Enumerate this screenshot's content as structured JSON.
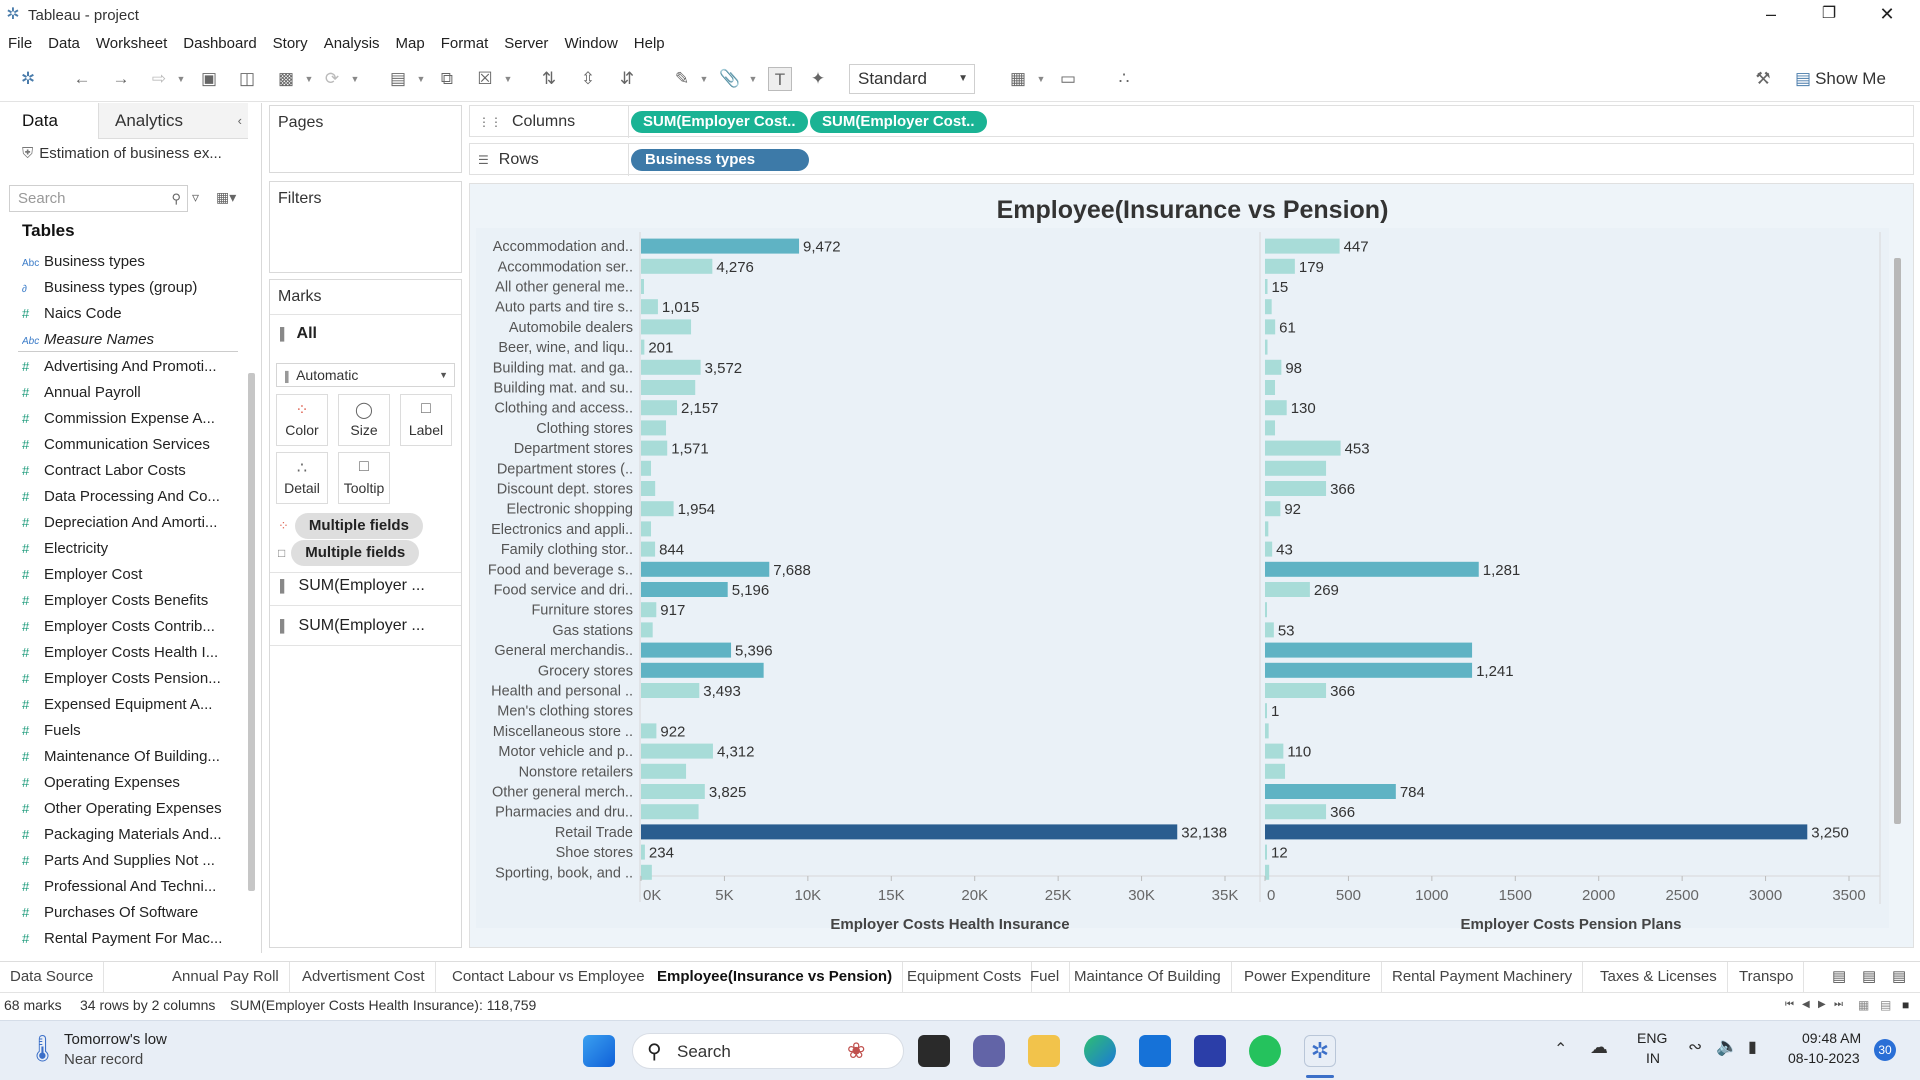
{
  "window": {
    "title": "Tableau - project"
  },
  "menu": [
    "File",
    "Data",
    "Worksheet",
    "Dashboard",
    "Story",
    "Analysis",
    "Map",
    "Format",
    "Server",
    "Window",
    "Help"
  ],
  "toolbar": {
    "fit_select": "Standard",
    "show_me": "Show Me"
  },
  "datapane": {
    "tab_data": "Data",
    "tab_analytics": "Analytics",
    "datasource": "Estimation of business ex...",
    "search_placeholder": "Search",
    "tables_heading": "Tables",
    "fields": [
      {
        "name": "Business types",
        "kind": "dim"
      },
      {
        "name": "Business types (group)",
        "kind": "group"
      },
      {
        "name": "Naics Code",
        "kind": "measure"
      },
      {
        "name": "Measure Names",
        "kind": "dim",
        "italic": true
      },
      {
        "name": "Advertising And Promoti...",
        "kind": "measure"
      },
      {
        "name": "Annual Payroll",
        "kind": "measure"
      },
      {
        "name": "Commission Expense A...",
        "kind": "measure"
      },
      {
        "name": "Communication Services",
        "kind": "measure"
      },
      {
        "name": "Contract Labor Costs",
        "kind": "measure"
      },
      {
        "name": "Data Processing And Co...",
        "kind": "measure"
      },
      {
        "name": "Depreciation And Amorti...",
        "kind": "measure"
      },
      {
        "name": "Electricity",
        "kind": "measure"
      },
      {
        "name": "Employer Cost",
        "kind": "measure"
      },
      {
        "name": "Employer Costs Benefits",
        "kind": "measure"
      },
      {
        "name": "Employer Costs Contrib...",
        "kind": "measure"
      },
      {
        "name": "Employer Costs Health I...",
        "kind": "measure"
      },
      {
        "name": "Employer Costs Pension...",
        "kind": "measure"
      },
      {
        "name": "Expensed Equipment A...",
        "kind": "measure"
      },
      {
        "name": "Fuels",
        "kind": "measure"
      },
      {
        "name": "Maintenance Of Building...",
        "kind": "measure"
      },
      {
        "name": "Operating Expenses",
        "kind": "measure"
      },
      {
        "name": "Other Operating Expenses",
        "kind": "measure"
      },
      {
        "name": "Packaging Materials And...",
        "kind": "measure"
      },
      {
        "name": "Parts And Supplies Not ...",
        "kind": "measure"
      },
      {
        "name": "Professional And Techni...",
        "kind": "measure"
      },
      {
        "name": "Purchases Of Software",
        "kind": "measure"
      },
      {
        "name": "Rental Payment For Mac...",
        "kind": "measure"
      }
    ]
  },
  "shelves": {
    "pages": "Pages",
    "filters": "Filters",
    "marks": "Marks",
    "marks_all": "All",
    "mark_type": "Automatic",
    "mark_buttons": [
      "Color",
      "Size",
      "Label",
      "Detail",
      "Tooltip"
    ],
    "mark_pills": [
      "Multiple fields",
      "Multiple fields"
    ],
    "mark_measures": [
      "SUM(Employer ...",
      "SUM(Employer ..."
    ],
    "columns_label": "Columns",
    "rows_label": "Rows",
    "column_pills": [
      "SUM(Employer Cost..",
      "SUM(Employer Cost.."
    ],
    "row_pill": "Business types"
  },
  "sheet_title": "Employee(Insurance vs Pension)",
  "chart_data": {
    "type": "bar",
    "title": "Employee(Insurance vs Pension)",
    "categories": [
      "Accommodation and..",
      "Accommodation ser..",
      "All other general me..",
      "Auto parts and tire s..",
      "Automobile dealers",
      "Beer, wine, and liqu..",
      "Building mat. and ga..",
      "Building mat. and su..",
      "Clothing and access..",
      "Clothing stores",
      "Department stores",
      "Department stores (..",
      "Discount dept. stores",
      "Electronic shopping",
      "Electronics and appli..",
      "Family clothing stor..",
      "Food and beverage s..",
      "Food service and dri..",
      "Furniture stores",
      "Gas stations",
      "General merchandis..",
      "Grocery stores",
      "Health and personal ..",
      "Men's clothing stores",
      "Miscellaneous store ..",
      "Motor vehicle and p..",
      "Nonstore retailers",
      "Other general merch..",
      "Pharmacies and dru..",
      "Retail Trade",
      "Shoe stores",
      "Sporting, book, and .."
    ],
    "series": [
      {
        "name": "Employer Costs Health Insurance",
        "values": [
          9472,
          4276,
          180,
          1015,
          3000,
          201,
          3572,
          3250,
          2157,
          1500,
          1571,
          600,
          850,
          1954,
          600,
          844,
          7688,
          5196,
          917,
          700,
          5396,
          7350,
          3493,
          0,
          922,
          4312,
          2700,
          3825,
          3450,
          32138,
          234,
          650
        ],
        "labels": [
          "9,472",
          "4,276",
          "",
          "1,015",
          "",
          "201",
          "3,572",
          "",
          "2,157",
          "",
          "1,571",
          "",
          "",
          "1,954",
          "",
          "844",
          "7,688",
          "5,196",
          "917",
          "",
          "5,396",
          "",
          "3,493",
          "",
          "922",
          "4,312",
          "",
          "3,825",
          "",
          "32,138",
          "234",
          ""
        ],
        "axis_label": "Employer Costs Health Insurance",
        "ticks": [
          "0K",
          "5K",
          "10K",
          "15K",
          "20K",
          "25K",
          "30K",
          "35K"
        ],
        "xlim": [
          0,
          36000
        ]
      },
      {
        "name": "Employer Costs Pension Plans",
        "values": [
          447,
          179,
          15,
          40,
          61,
          15,
          98,
          60,
          130,
          60,
          453,
          366,
          366,
          92,
          20,
          43,
          1281,
          269,
          10,
          53,
          1241,
          1241,
          366,
          1,
          22,
          110,
          120,
          784,
          366,
          3250,
          12,
          25
        ],
        "labels": [
          "447",
          "179",
          "15",
          "",
          "61",
          "",
          "98",
          "",
          "130",
          "",
          "453",
          "",
          "366",
          "92",
          "",
          "43",
          "1,281",
          "269",
          "",
          "53",
          "",
          "1,241",
          "366",
          "1",
          "",
          "110",
          "",
          "784",
          "366",
          "3,250",
          "12",
          ""
        ],
        "axis_label": "Employer Costs Pension Plans",
        "ticks": [
          "0",
          "500",
          "1000",
          "1500",
          "2000",
          "2500",
          "3000",
          "3500"
        ],
        "xlim": [
          0,
          3500
        ]
      }
    ]
  },
  "sheet_tabs": [
    "Data Source",
    "Annual Pay Roll",
    "Advertisment Cost",
    "Contact Labour vs Employee",
    "Employee(Insurance vs Pension)",
    "Equipment Costs",
    "Fuel",
    "Maintance Of Building",
    "Power Expenditure",
    "Rental Payment Machinery",
    "Taxes & Licenses",
    "Transpo"
  ],
  "active_tab": "Employee(Insurance vs Pension)",
  "status": {
    "marks": "68 marks",
    "dims": "34 rows by 2 columns",
    "sum": "SUM(Employer Costs Health Insurance): 118,759"
  },
  "taskbar": {
    "weather_title": "Tomorrow's low",
    "weather_sub": "Near record",
    "search": "Search",
    "lang1": "ENG",
    "lang2": "IN",
    "time": "09:48 AM",
    "date": "08-10-2023",
    "badge": "30"
  },
  "colors": {
    "low": "#a8dcd8",
    "mid": "#5fb3c4",
    "high": "#2a5d8f"
  }
}
